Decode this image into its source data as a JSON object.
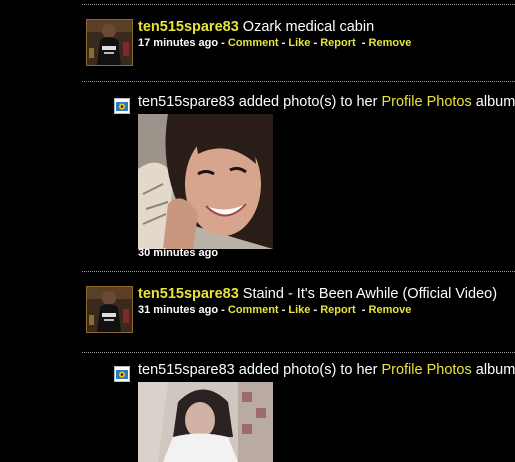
{
  "feed": [
    {
      "type": "status",
      "user": "ten515spare83",
      "text": "Ozark medical cabin",
      "time": "17 minutes ago",
      "actions": [
        "Comment",
        "Like",
        "Report",
        "Remove"
      ]
    },
    {
      "type": "photo",
      "user": "ten515spare83",
      "pre": "added photo(s) to her",
      "album": "Profile Photos",
      "post": "album:",
      "time": "30 minutes ago"
    },
    {
      "type": "status",
      "user": "ten515spare83",
      "text": "Staind - It's Been Awhile (Official Video)",
      "time": "31 minutes ago",
      "actions": [
        "Comment",
        "Like",
        "Report",
        "Remove"
      ]
    },
    {
      "type": "photo",
      "user": "ten515spare83",
      "pre": "added photo(s) to her",
      "album": "Profile Photos",
      "post": "album:"
    }
  ],
  "colors": {
    "background": "#000000",
    "link": "#e8e23a",
    "text": "#ffffff",
    "divider": "#9a9a9a"
  },
  "icons": {
    "album": "camera-icon"
  }
}
